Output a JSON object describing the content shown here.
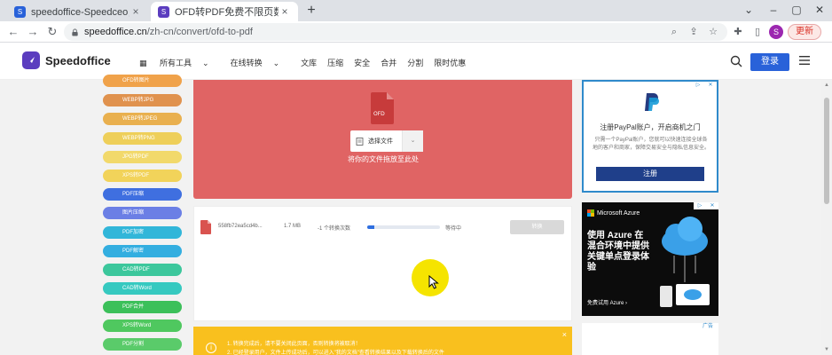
{
  "browser": {
    "tabs": [
      {
        "title": "speedoffice-Speedceo，做首己",
        "active": false
      },
      {
        "title": "OFD转PDF免费不限页数, OFD在",
        "active": true
      }
    ],
    "new_tab_label": "+",
    "address": {
      "domain": "speedoffice.cn",
      "path": "/zh-cn/convert/ofd-to-pdf"
    },
    "profile_initial": "S",
    "update_label": "更新"
  },
  "site": {
    "logo_text": "Speedoffice",
    "nav": [
      "所有工具",
      "在线转换",
      "文库",
      "压缩",
      "安全",
      "合并",
      "分割",
      "限时优惠"
    ],
    "login_label": "登录"
  },
  "sidebar": {
    "items": [
      {
        "label": "OFD转图片",
        "color": "#f0a24a"
      },
      {
        "label": "WEBP转JPG",
        "color": "#e0924e"
      },
      {
        "label": "WEBP转JPEG",
        "color": "#e9b04f"
      },
      {
        "label": "WEBP转PNG",
        "color": "#eecf5a"
      },
      {
        "label": "JPG转PDF",
        "color": "#f2d96b"
      },
      {
        "label": "XPS转PDF",
        "color": "#f2d35a"
      },
      {
        "label": "PDF压缩",
        "color": "#3f6fe0"
      },
      {
        "label": "图片压缩",
        "color": "#6b7fe5"
      },
      {
        "label": "PDF加密",
        "color": "#31b6d9"
      },
      {
        "label": "PDF解密",
        "color": "#33aee0"
      },
      {
        "label": "CAD转PDF",
        "color": "#3cc79c"
      },
      {
        "label": "CAD转Word",
        "color": "#36c9c0"
      },
      {
        "label": "PDF合并",
        "color": "#3cc05a"
      },
      {
        "label": "XPS转Word",
        "color": "#4fc85f"
      },
      {
        "label": "PDF分割",
        "color": "#5acb6a"
      }
    ]
  },
  "upload": {
    "file_badge": "OFD",
    "choose_label": "选择文件",
    "drop_hint": "将你的文件拖放至此处"
  },
  "file": {
    "name": "558fb72ea5cd4b...",
    "size": "1.7 MB",
    "count": "-1 个转换次数",
    "progress": 0.1,
    "status": "等待中",
    "button_label": "转换"
  },
  "notice": {
    "line1": "1. 转换完成后，请不要关闭此页面，否则转换将被取消！",
    "line2": "2. 已经登录用户，文件上传成功后，可以进入\"我的文档\"查看转换结果以及下载转换后的文件",
    "info_glyph": "i",
    "close_glyph": "×"
  },
  "ads": {
    "paypal": {
      "headline": "注册PayPal账户，开启商机之门",
      "body": "只需一个PayPal账户，您就可以快速连接全球各地的客户和商家，保障交易安全与隐私信息安全。",
      "button": "注册"
    },
    "azure": {
      "brand": "Microsoft Azure",
      "headline": "使用 Azure 在混合环境中提供关键单点登录体验",
      "cta": "免费试用 Azure"
    },
    "ad_badge": "广告"
  },
  "colors": {
    "upload_bg": "#e06464",
    "primary": "#2962d9",
    "notice": "#f9c01e"
  }
}
